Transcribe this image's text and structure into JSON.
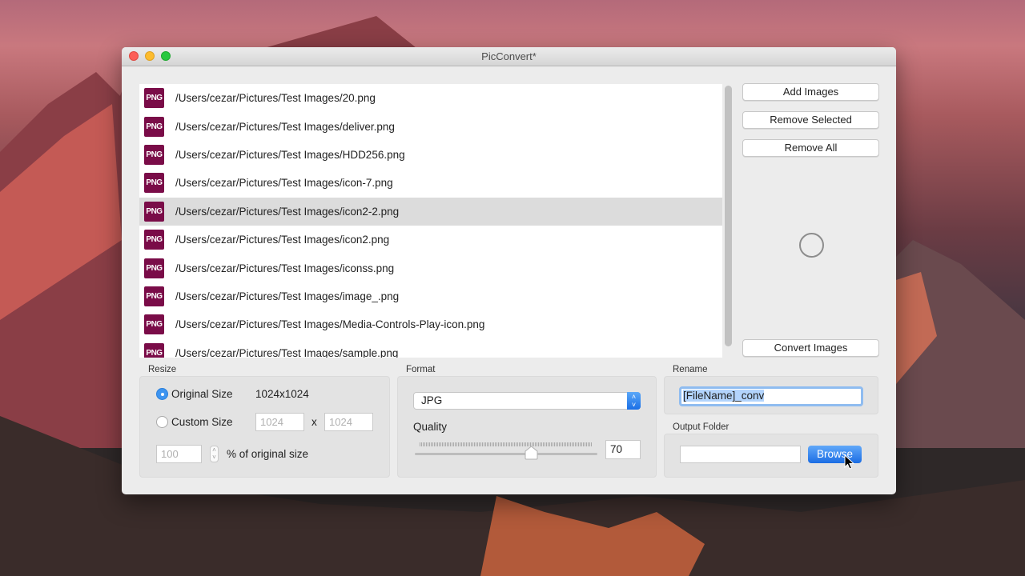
{
  "window": {
    "title": "PicConvert*"
  },
  "files": [
    {
      "type": "PNG",
      "path": "/Users/cezar/Pictures/Test Images/20.png",
      "selected": false
    },
    {
      "type": "PNG",
      "path": "/Users/cezar/Pictures/Test Images/deliver.png",
      "selected": false
    },
    {
      "type": "PNG",
      "path": "/Users/cezar/Pictures/Test Images/HDD256.png",
      "selected": false
    },
    {
      "type": "PNG",
      "path": "/Users/cezar/Pictures/Test Images/icon-7.png",
      "selected": false
    },
    {
      "type": "PNG",
      "path": "/Users/cezar/Pictures/Test Images/icon2-2.png",
      "selected": true
    },
    {
      "type": "PNG",
      "path": "/Users/cezar/Pictures/Test Images/icon2.png",
      "selected": false
    },
    {
      "type": "PNG",
      "path": "/Users/cezar/Pictures/Test Images/iconss.png",
      "selected": false
    },
    {
      "type": "PNG",
      "path": "/Users/cezar/Pictures/Test Images/image_.png",
      "selected": false
    },
    {
      "type": "PNG",
      "path": "/Users/cezar/Pictures/Test Images/Media-Controls-Play-icon.png",
      "selected": false
    },
    {
      "type": "PNG",
      "path": "/Users/cezar/Pictures/Test Images/sample.png",
      "selected": false
    }
  ],
  "actions": {
    "add": "Add Images",
    "remove_selected": "Remove Selected",
    "remove_all": "Remove All",
    "convert": "Convert Images"
  },
  "resize": {
    "label": "Resize",
    "original_label": "Original Size",
    "original_value": "1024x1024",
    "custom_label": "Custom Size",
    "width_placeholder": "1024",
    "height_placeholder": "1024",
    "times": "x",
    "percent_value": "100",
    "percent_label": "% of original size",
    "selected": "original"
  },
  "format": {
    "label": "Format",
    "selected": "JPG",
    "quality_label": "Quality",
    "quality_value": "70",
    "quality_slider_percent": 70
  },
  "rename": {
    "label": "Rename",
    "value": "[FileName]_conv"
  },
  "output": {
    "label": "Output Folder",
    "value": "",
    "browse_label": "Browse"
  },
  "colors": {
    "png_badge": "#7a0c48",
    "accent": "#3d94f0"
  }
}
